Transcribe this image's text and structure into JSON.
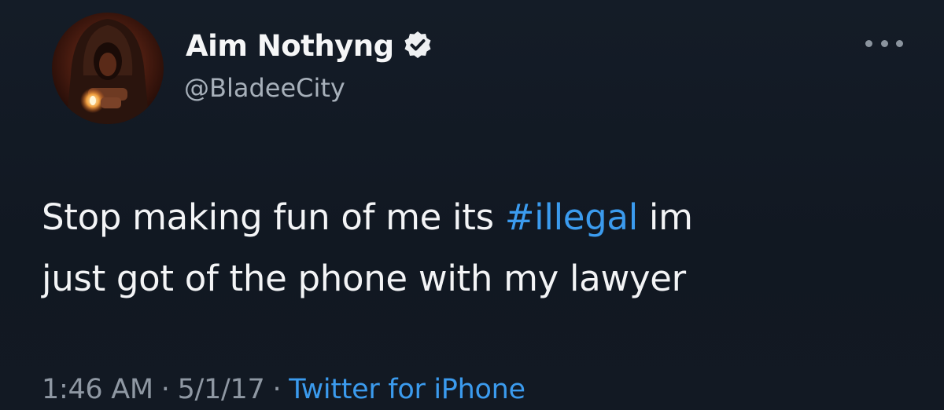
{
  "user": {
    "display_name": "Aim Nothyng",
    "handle": "@BladeeCity",
    "verified": true,
    "avatar_icon": "hooded-figure-avatar"
  },
  "tweet": {
    "text_line1_before": "Stop making fun of me its ",
    "hashtag": "#illegal",
    "text_line1_after": " im",
    "text_line2": "just got of the phone with my lawyer"
  },
  "meta": {
    "time": "1:46 AM",
    "separator": "·",
    "date": "5/1/17",
    "source": "Twitter for iPhone"
  },
  "icons": {
    "verified": "verified-badge-icon",
    "more": "more-options-icon"
  },
  "colors": {
    "background": "#121923",
    "link": "#3b9bee",
    "text": "#f3f4f6",
    "muted": "#8f98a3"
  }
}
